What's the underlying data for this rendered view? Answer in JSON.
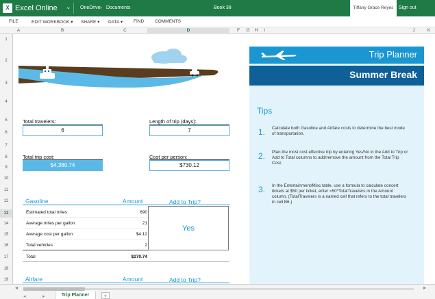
{
  "titlebar": {
    "app_name": "Excel Online",
    "breadcrumb_root": "OneDrive",
    "breadcrumb_sep": "›",
    "breadcrumb_folder": "Documents",
    "document": "Book 38",
    "user": "Tiffany Grace Reyes",
    "sign_out": "Sign out"
  },
  "menu": [
    "FILE",
    "EDIT WORKBOOK ▾",
    "SHARE ▾",
    "DATA ▾",
    "FIND",
    "COMMENTS"
  ],
  "columns": [
    "A",
    "B",
    "C",
    "D",
    "F",
    "G",
    "H",
    "I",
    "J",
    "K"
  ],
  "rows": [
    "1",
    "2",
    "3",
    "4",
    "5",
    "6",
    "7",
    "8",
    "9",
    "10",
    "11",
    "12",
    "13",
    "14",
    "15",
    "16",
    "17",
    "18",
    "19"
  ],
  "selected": {
    "column": "D",
    "row": "13"
  },
  "planner": {
    "total_travelers_label": "Total travelers:",
    "total_travelers": "6",
    "trip_length_label": "Length of trip (days):",
    "trip_length": "7",
    "total_cost_label": "Total trip cost:",
    "total_cost": "$4,380.74",
    "cost_per_person_label": "Cost per person:",
    "cost_per_person": "$730.12"
  },
  "gasoline": {
    "title": "Gasoline",
    "amount_header": "Amount",
    "add_header": "Add to Trip?",
    "rows": [
      {
        "label": "Estimated total miles",
        "value": "690"
      },
      {
        "label": "Average miles per gallon",
        "value": "21"
      },
      {
        "label": "Average cost per gallon",
        "value": "$4.12"
      },
      {
        "label": "Total vehicles",
        "value": "2"
      }
    ],
    "total_label": "Total",
    "total_value": "$270.74",
    "add_value": "Yes"
  },
  "airfare": {
    "title": "Airfare",
    "amount_header": "Amount",
    "add_header": "Add to Trip?"
  },
  "panel": {
    "banner1": "Trip Planner",
    "banner2": "Summer Break",
    "tips_title": "Tips",
    "tips": [
      {
        "num": "1.",
        "text": "Calculate both Gasoline and Airfare costs to determine the best mode of transportation."
      },
      {
        "num": "2.",
        "text": "Plan the most cost effective trip by entering Yes/No in the Add to Trip or Add to Total columns to add/remove the amount from the Total Trip Cost."
      },
      {
        "num": "3.",
        "text": "In the Entertainment/Misc table, use a formula to calculate concert tickets at $50 per ticket, enter =50*TotalTravelers in the Amount column. (TotalTravelers is a named cell that refers to the total travelers in cell B6.)"
      }
    ]
  },
  "sheet_tab": "Trip Planner",
  "add_sheet": "+",
  "colors": {
    "excel_green": "#1f7a45",
    "accent_blue": "#1a97d1",
    "dark_blue": "#0f5f99",
    "panel_bg": "#e3f3fb"
  }
}
